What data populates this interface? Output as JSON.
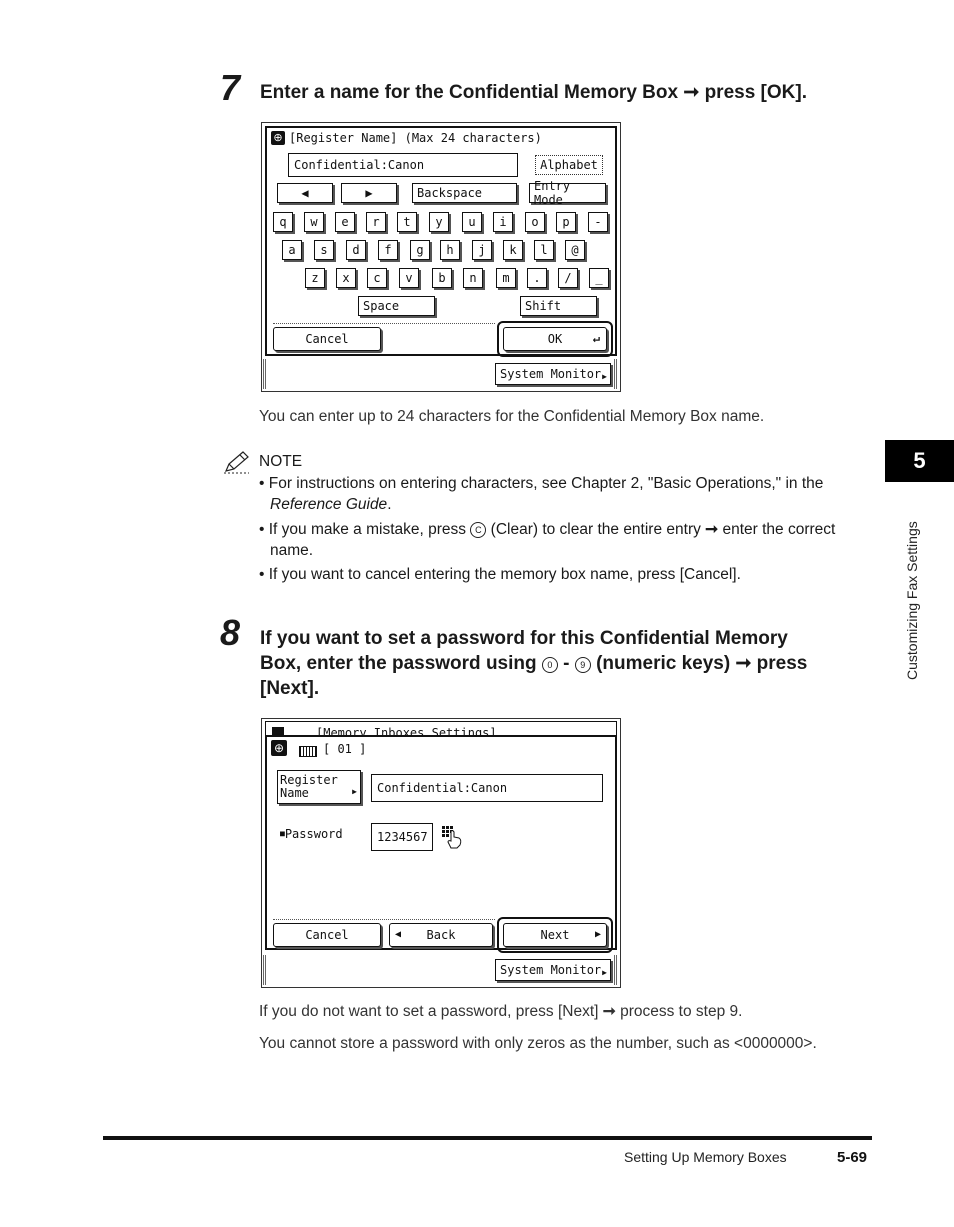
{
  "step7": {
    "number": "7",
    "title_before": "Enter a name for the Confidential Memory Box",
    "arrow": "➞",
    "title_after": "press [OK]."
  },
  "screen1": {
    "header": "[Register Name] (Max 24 characters)",
    "input_value": "Confidential:Canon",
    "mode_label": "Alphabet",
    "left_arrow": "◀",
    "right_arrow": "▶",
    "backspace": "Backspace",
    "entry_mode": "Entry Mode",
    "row1": [
      "q",
      "w",
      "e",
      "r",
      "t",
      "y",
      "u",
      "i",
      "o",
      "p",
      "-"
    ],
    "row2": [
      "a",
      "s",
      "d",
      "f",
      "g",
      "h",
      "j",
      "k",
      "l",
      "@"
    ],
    "row3": [
      "z",
      "x",
      "c",
      "v",
      "b",
      "n",
      "m",
      ".",
      "/",
      "_"
    ],
    "space": "Space",
    "shift": "Shift",
    "cancel": "Cancel",
    "ok": "OK",
    "enter_symbol": "↵",
    "system_monitor": "System Monitor"
  },
  "text1": "You can enter up to 24 characters for the Confidential Memory Box name.",
  "note": {
    "heading": "NOTE",
    "item1_text": "For instructions on entering characters, see Chapter 2, \"Basic Operations,\" in the",
    "item1_italic": "Reference Guide",
    "item1_end": ".",
    "item2_before": "If you make a mistake, press",
    "item2_key": "C",
    "item2_after": "(Clear) to clear the entire entry",
    "item2_arrow": "➞",
    "item2_end": "enter the correct",
    "item2_line2": "name.",
    "item3": "If you want to cancel entering the memory box name, press [Cancel]."
  },
  "step8": {
    "number": "8",
    "line1": "If you want to set a password for this Confidential Memory",
    "line2_before": "Box, enter the password using",
    "key0": "0",
    "dash": "-",
    "key9": "9",
    "line2_after": "(numeric keys)",
    "arrow": "➞",
    "line2_end": "press",
    "line3": "[Next]."
  },
  "screen2": {
    "top_header": "[Memory Inboxes Settings]",
    "box_number": "[ 01 ]",
    "register_name_line1": "Register",
    "register_name_line2": "Name",
    "name_value": "Confidential:Canon",
    "password_label": "Password",
    "password_value": "1234567",
    "cancel": "Cancel",
    "back": "Back",
    "next": "Next",
    "back_arrow": "◀",
    "next_arrow": "▶",
    "system_monitor": "System Monitor"
  },
  "text2": "If you do not want to set a password, press [Next]",
  "text2_arrow": "➞",
  "text2_end": "process to step 9.",
  "text3": "You cannot store a password with only zeros as the number, such as <0000000>.",
  "side_tab": {
    "number": "5",
    "label": "Customizing Fax Settings"
  },
  "footer": {
    "section": "Setting Up Memory Boxes",
    "page": "5-69"
  }
}
